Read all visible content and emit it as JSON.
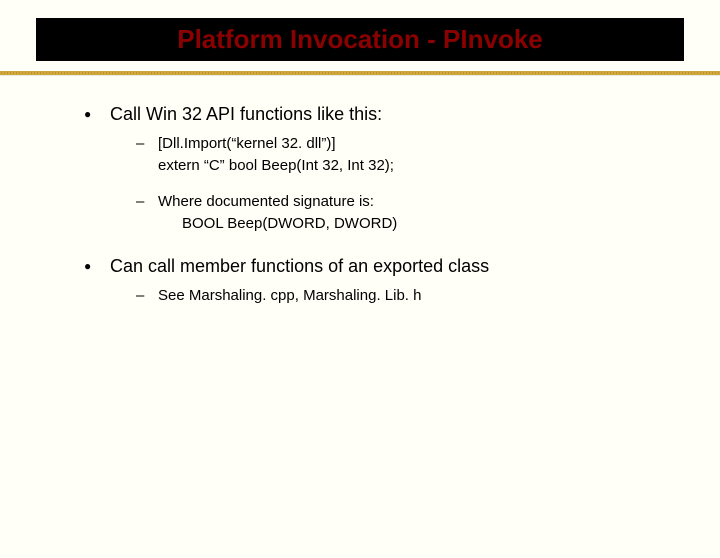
{
  "title": "Platform Invocation - PInvoke",
  "bullets": [
    {
      "text": "Call Win 32 API functions like this:",
      "sub": [
        {
          "line1": "[Dll.Import(“kernel 32. dll”)]",
          "line2": "extern “C” bool Beep(Int 32, Int 32);"
        },
        {
          "line1": "Where documented signature is:",
          "line2": "BOOL Beep(DWORD, DWORD)"
        }
      ]
    },
    {
      "text": "Can call member functions of an exported class",
      "sub": [
        {
          "line1": "See Marshaling. cpp, Marshaling. Lib. h"
        }
      ]
    }
  ]
}
